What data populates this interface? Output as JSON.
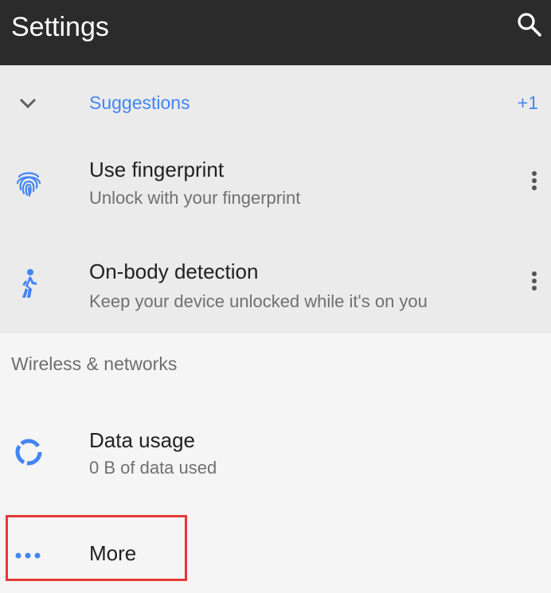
{
  "appbar": {
    "title": "Settings",
    "search_icon": "search-icon"
  },
  "suggestions": {
    "label": "Suggestions",
    "count": "+1",
    "items": [
      {
        "title": "Use fingerprint",
        "subtitle": "Unlock with your fingerprint",
        "icon": "fingerprint-icon"
      },
      {
        "title": "On-body detection",
        "subtitle": "Keep your device unlocked while it's on you",
        "icon": "walking-person-icon"
      }
    ]
  },
  "sections": [
    {
      "title": "Wireless & networks",
      "items": [
        {
          "title": "Data usage",
          "subtitle": "0 B of data used",
          "icon": "data-usage-icon"
        },
        {
          "title": "More",
          "icon": "more-dots-icon"
        }
      ]
    }
  ],
  "colors": {
    "accent": "#4285f4",
    "appbar_bg": "#2b2b2b",
    "suggest_bg": "#ebebeb",
    "page_bg": "#f5f5f5",
    "highlight": "#e53935"
  }
}
